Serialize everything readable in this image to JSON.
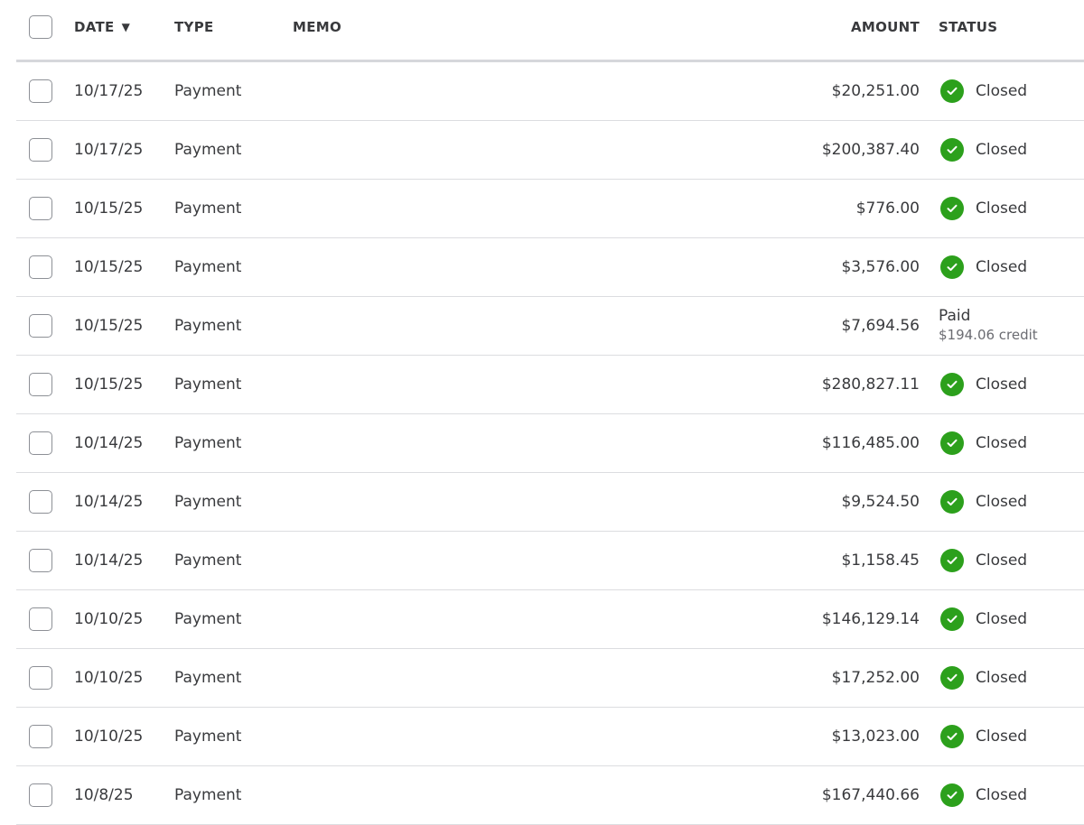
{
  "header": {
    "date": "DATE",
    "date_sort": "▼",
    "type": "TYPE",
    "memo": "MEMO",
    "amount": "AMOUNT",
    "status": "STATUS"
  },
  "colors": {
    "accent_green": "#2ca01c",
    "text": "#393a3d",
    "divider": "#dcdde0"
  },
  "rows": [
    {
      "date": "10/17/25",
      "type": "Payment",
      "amount": "$20,251.00",
      "status": "Closed",
      "status_icon": "check-circle-icon"
    },
    {
      "date": "10/17/25",
      "type": "Payment",
      "amount": "$200,387.40",
      "status": "Closed",
      "status_icon": "check-circle-icon"
    },
    {
      "date": "10/15/25",
      "type": "Payment",
      "amount": "$776.00",
      "status": "Closed",
      "status_icon": "check-circle-icon"
    },
    {
      "date": "10/15/25",
      "type": "Payment",
      "amount": "$3,576.00",
      "status": "Closed",
      "status_icon": "check-circle-icon"
    },
    {
      "date": "10/15/25",
      "type": "Payment",
      "amount": "$7,694.56",
      "status": "Paid",
      "status_sub": "$194.06 credit"
    },
    {
      "date": "10/15/25",
      "type": "Payment",
      "amount": "$280,827.11",
      "status": "Closed",
      "status_icon": "check-circle-icon"
    },
    {
      "date": "10/14/25",
      "type": "Payment",
      "amount": "$116,485.00",
      "status": "Closed",
      "status_icon": "check-circle-icon"
    },
    {
      "date": "10/14/25",
      "type": "Payment",
      "amount": "$9,524.50",
      "status": "Closed",
      "status_icon": "check-circle-icon"
    },
    {
      "date": "10/14/25",
      "type": "Payment",
      "amount": "$1,158.45",
      "status": "Closed",
      "status_icon": "check-circle-icon"
    },
    {
      "date": "10/10/25",
      "type": "Payment",
      "amount": "$146,129.14",
      "status": "Closed",
      "status_icon": "check-circle-icon"
    },
    {
      "date": "10/10/25",
      "type": "Payment",
      "amount": "$17,252.00",
      "status": "Closed",
      "status_icon": "check-circle-icon"
    },
    {
      "date": "10/10/25",
      "type": "Payment",
      "amount": "$13,023.00",
      "status": "Closed",
      "status_icon": "check-circle-icon"
    },
    {
      "date": "10/8/25",
      "type": "Payment",
      "amount": "$167,440.66",
      "status": "Closed",
      "status_icon": "check-circle-icon"
    }
  ]
}
